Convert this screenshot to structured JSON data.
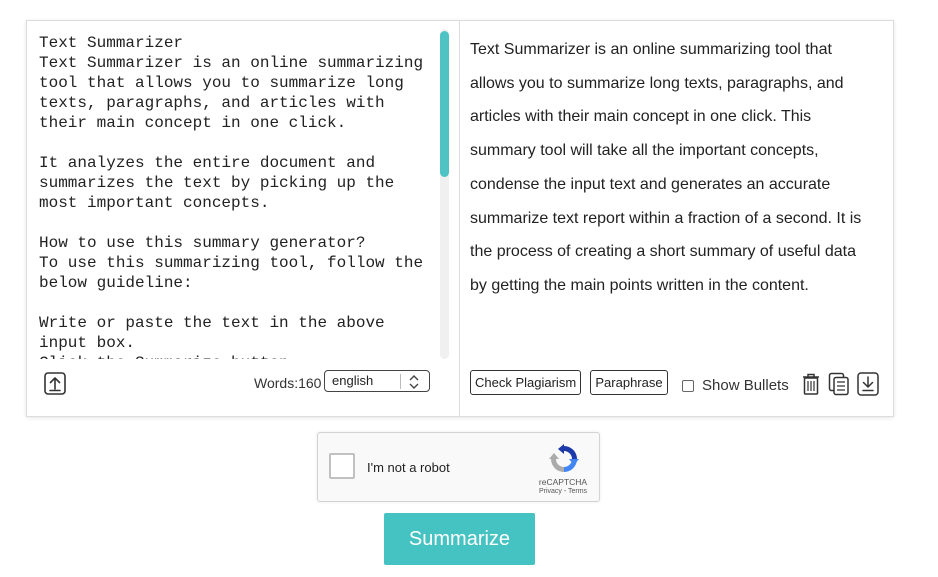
{
  "input": {
    "text": "Text Summarizer\nText Summarizer is an online summarizing tool that allows you to summarize long texts, paragraphs, and articles with their main concept in one click.\n\nIt analyzes the entire document and summarizes the text by picking up the most important concepts.\n\nHow to use this summary generator?\nTo use this summarizing tool, follow the below guideline:\n\nWrite or paste the text in the above input box.\nClick the Summarize button."
  },
  "footer_left": {
    "upload_icon": "upload-icon",
    "words_label": "Words:160",
    "language": "english"
  },
  "output": {
    "text": "Text Summarizer is an online summarizing tool that allows you to summarize long texts, paragraphs, and articles with their main concept in one click. This summary tool will take all the important concepts, condense the input text and generates an accurate summarize text report within a fraction of a second. It is the process of creating a short summary of useful data by getting the main points written in the content."
  },
  "footer_right": {
    "check_plagiarism": "Check Plagiarism",
    "paraphrase": "Paraphrase",
    "show_bullets": "Show Bullets",
    "icons": [
      "trash-icon",
      "copy-icon",
      "download-icon"
    ]
  },
  "recaptcha": {
    "label": "I'm not a robot",
    "brand": "reCAPTCHA",
    "links": "Privacy - Terms"
  },
  "actions": {
    "summarize": "Summarize"
  },
  "colors": {
    "accent": "#45c2c2",
    "scroll_thumb": "#4fc3c3"
  }
}
